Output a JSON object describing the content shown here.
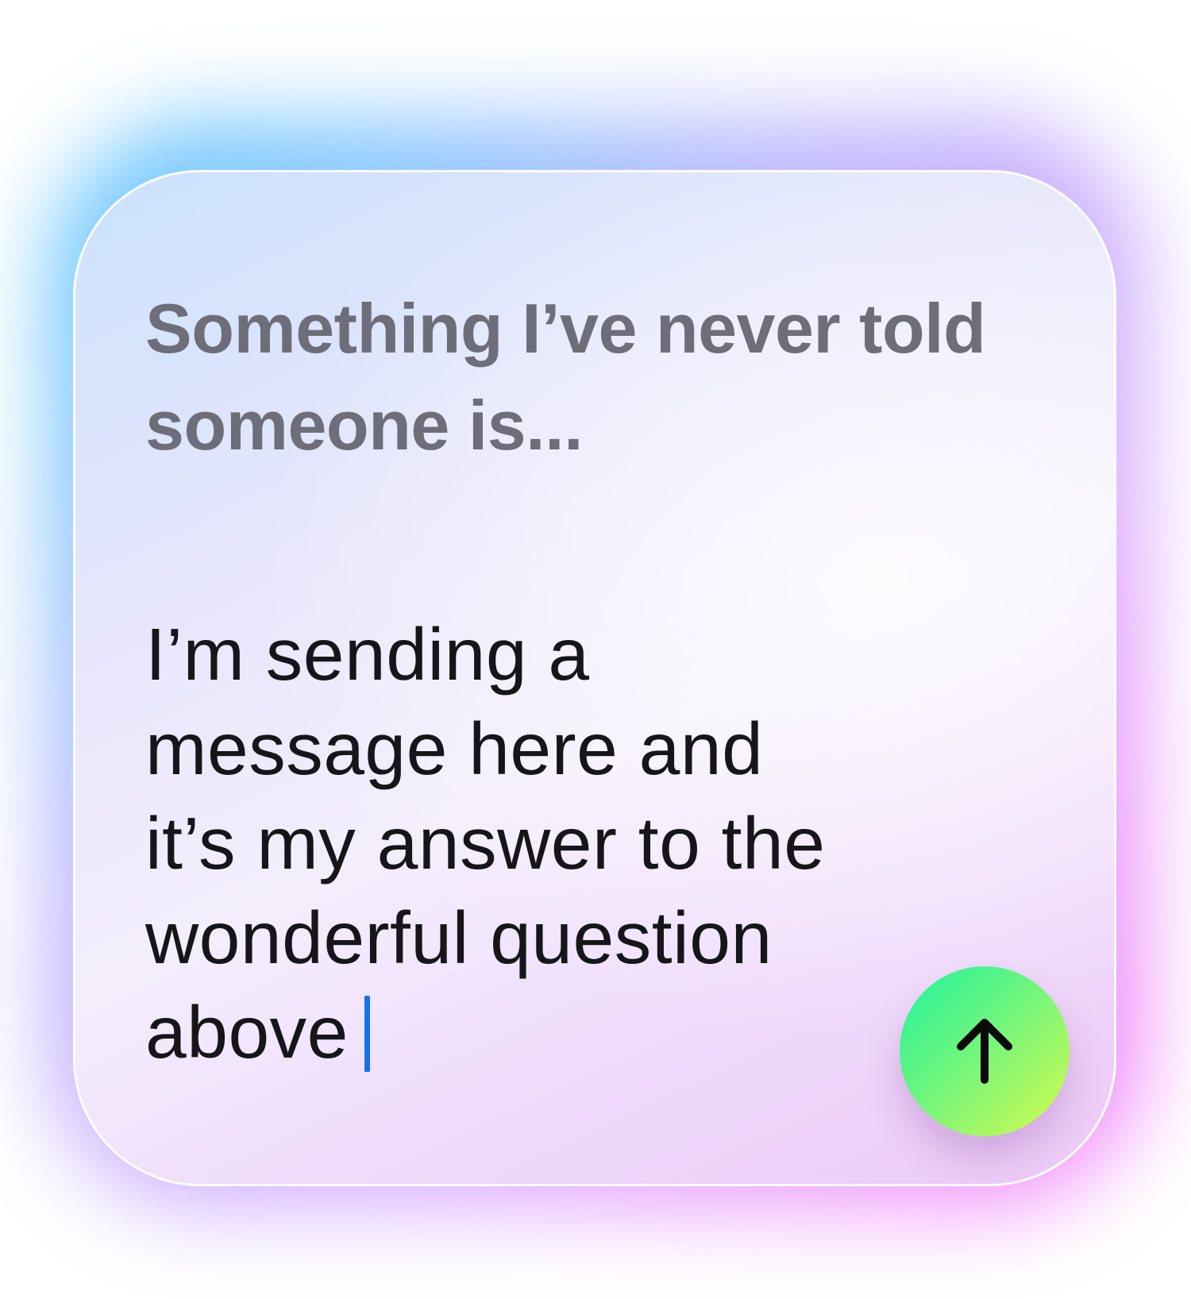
{
  "prompt_card": {
    "question": "Something I’ve never told someone is...",
    "answer": {
      "value": "I’m sending a\nmessage here and\nit’s my answer to the\nwonderful question\nabove",
      "caret_color": "#1272ea"
    },
    "send_button": {
      "icon": "arrow-up-icon",
      "gradient_start": "#1ef39d",
      "gradient_end": "#d8fb4c"
    }
  },
  "colors": {
    "question_text": "#6d6e79",
    "answer_text": "#16161a",
    "glow_left": "#50beff",
    "glow_right": "#f06eff"
  }
}
